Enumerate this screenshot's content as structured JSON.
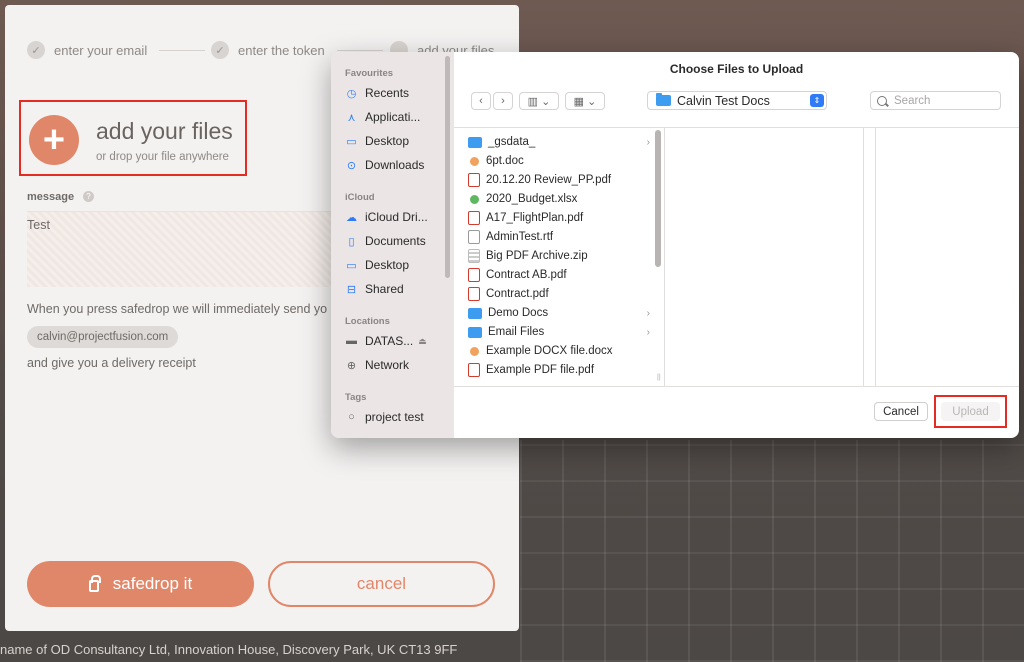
{
  "background": {
    "footer_text": "name of OD Consultancy Ltd, Innovation House, Discovery Park, UK CT13 9FF"
  },
  "steps": [
    {
      "label": "enter your email",
      "done": true
    },
    {
      "label": "enter the token",
      "done": true
    },
    {
      "label": "add your files",
      "done": false
    }
  ],
  "add_files": {
    "title": "add your files",
    "subtitle": "or drop your file anywhere",
    "plus_symbol": "+"
  },
  "message": {
    "label": "message",
    "value": "Test"
  },
  "notice": {
    "press_text": "When you press safedrop we will immediately send yo",
    "email": "calvin@projectfusion.com",
    "receipt_text": "and give you a delivery receipt"
  },
  "actions": {
    "safedrop_label": "safedrop it",
    "cancel_label": "cancel"
  },
  "dialog": {
    "title": "Choose Files to Upload",
    "location": "Calvin Test Docs",
    "search_placeholder": "Search",
    "sidebar": {
      "favourites_heading": "Favourites",
      "favourites": [
        {
          "label": "Recents",
          "icon": "clock-icon"
        },
        {
          "label": "Applicati...",
          "icon": "applications-icon"
        },
        {
          "label": "Desktop",
          "icon": "desktop-icon"
        },
        {
          "label": "Downloads",
          "icon": "download-icon"
        }
      ],
      "icloud_heading": "iCloud",
      "icloud": [
        {
          "label": "iCloud Dri...",
          "icon": "cloud-icon"
        },
        {
          "label": "Documents",
          "icon": "document-icon"
        },
        {
          "label": "Desktop",
          "icon": "desktop-icon"
        },
        {
          "label": "Shared",
          "icon": "shared-folder-icon"
        }
      ],
      "locations_heading": "Locations",
      "locations": [
        {
          "label": "DATAS...",
          "icon": "drive-icon"
        },
        {
          "label": "Network",
          "icon": "globe-icon"
        }
      ],
      "tags_heading": "Tags",
      "tags": [
        {
          "label": "project test"
        }
      ]
    },
    "files": [
      {
        "name": "_gsdata_",
        "type": "folder"
      },
      {
        "name": "6pt.doc",
        "type": "doc"
      },
      {
        "name": "20.12.20 Review_PP.pdf",
        "type": "pdf"
      },
      {
        "name": "2020_Budget.xlsx",
        "type": "xls"
      },
      {
        "name": "A17_FlightPlan.pdf",
        "type": "pdf"
      },
      {
        "name": "AdminTest.rtf",
        "type": "rtf"
      },
      {
        "name": "Big PDF Archive.zip",
        "type": "zip"
      },
      {
        "name": "Contract AB.pdf",
        "type": "pdf"
      },
      {
        "name": "Contract.pdf",
        "type": "pdf"
      },
      {
        "name": "Demo Docs",
        "type": "folder"
      },
      {
        "name": "Email Files",
        "type": "folder"
      },
      {
        "name": "Example DOCX file.docx",
        "type": "doc"
      },
      {
        "name": "Example PDF file.pdf",
        "type": "pdf"
      }
    ],
    "cancel_label": "Cancel",
    "upload_label": "Upload"
  },
  "colors": {
    "accent": "#e0876a",
    "highlight_border": "#e42b24",
    "mac_blue": "#2f7bf5"
  }
}
